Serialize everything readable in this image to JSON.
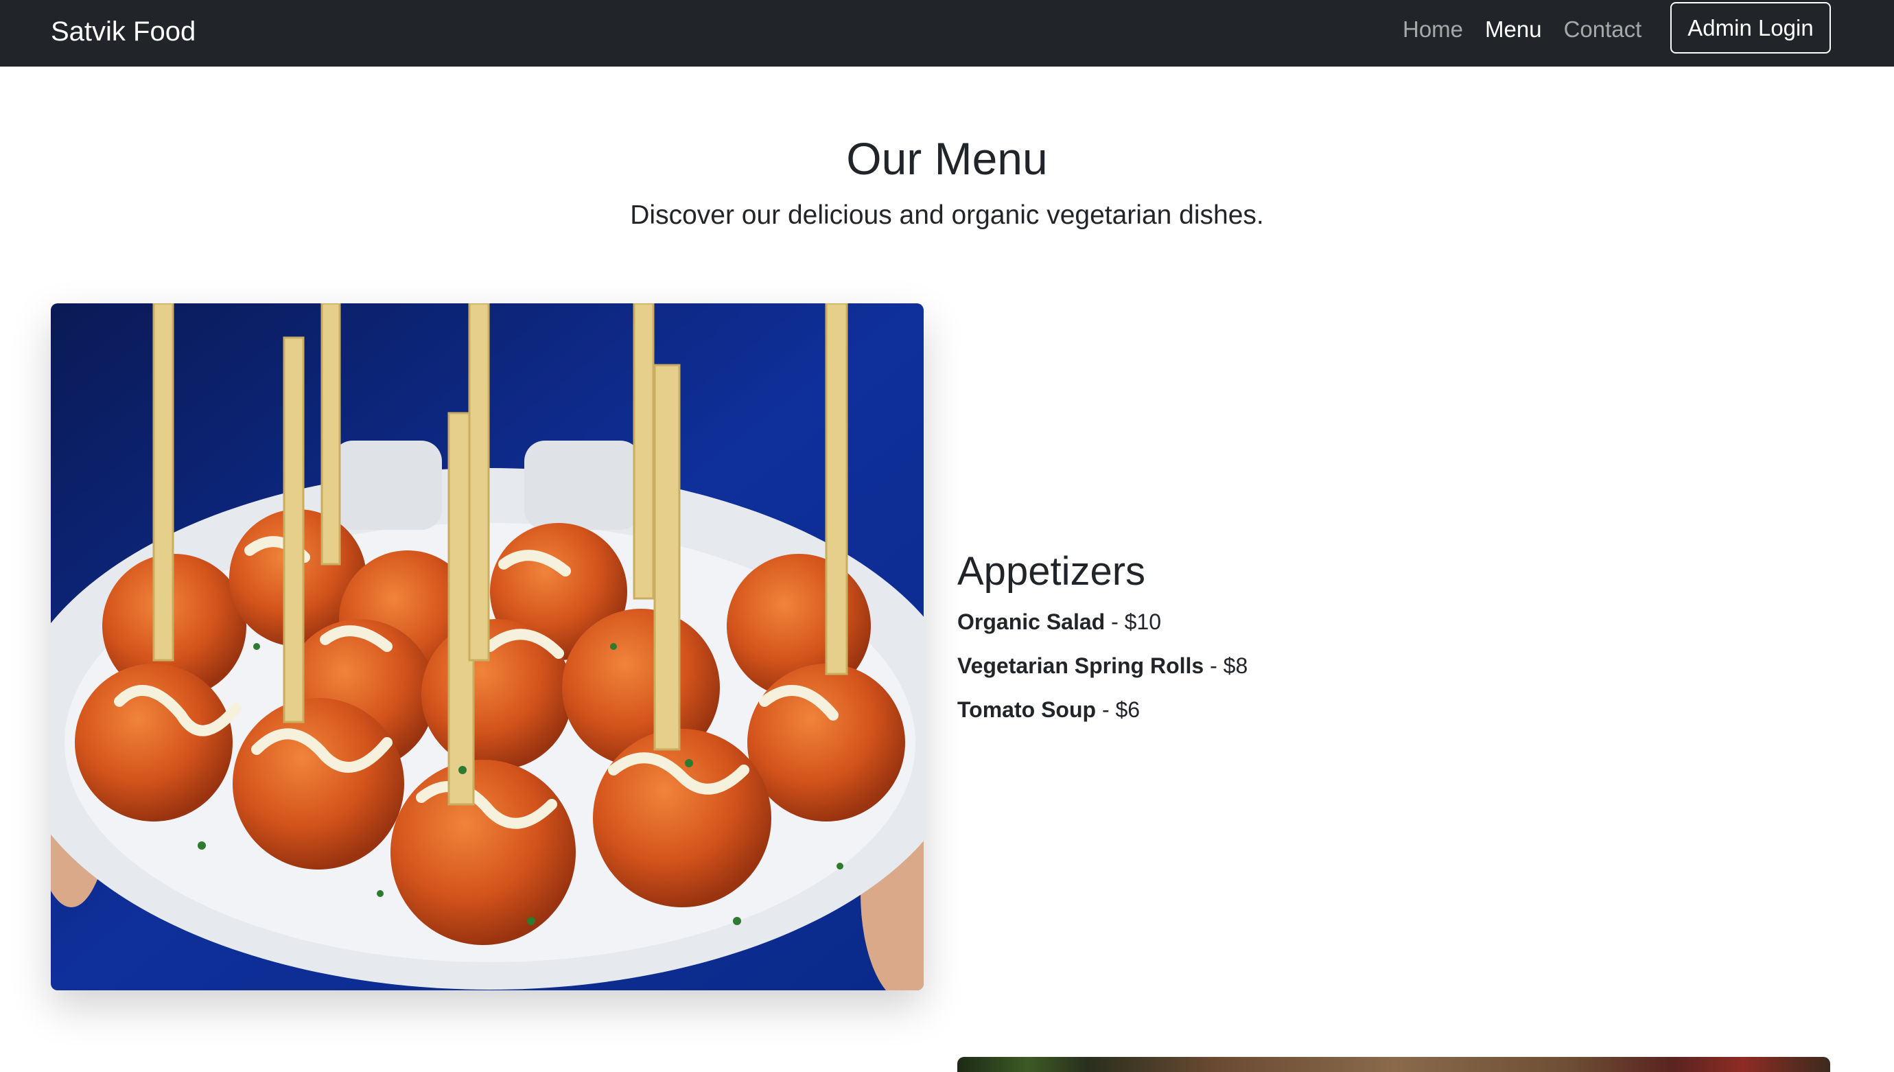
{
  "navbar": {
    "brand": "Satvik Food",
    "links": [
      {
        "label": "Home",
        "active": false
      },
      {
        "label": "Menu",
        "active": true
      },
      {
        "label": "Contact",
        "active": false
      }
    ],
    "admin_login_label": "Admin Login"
  },
  "hero": {
    "title": "Our Menu",
    "subtitle": "Discover our delicious and organic vegetarian dishes."
  },
  "sections": [
    {
      "title": "Appetizers",
      "items": [
        {
          "name": "Organic Salad",
          "price": "$10"
        },
        {
          "name": "Vegetarian Spring Rolls",
          "price": "$8"
        },
        {
          "name": "Tomato Soup",
          "price": "$6"
        }
      ]
    }
  ],
  "colors": {
    "navbar_bg": "#212529",
    "text": "#212529"
  }
}
